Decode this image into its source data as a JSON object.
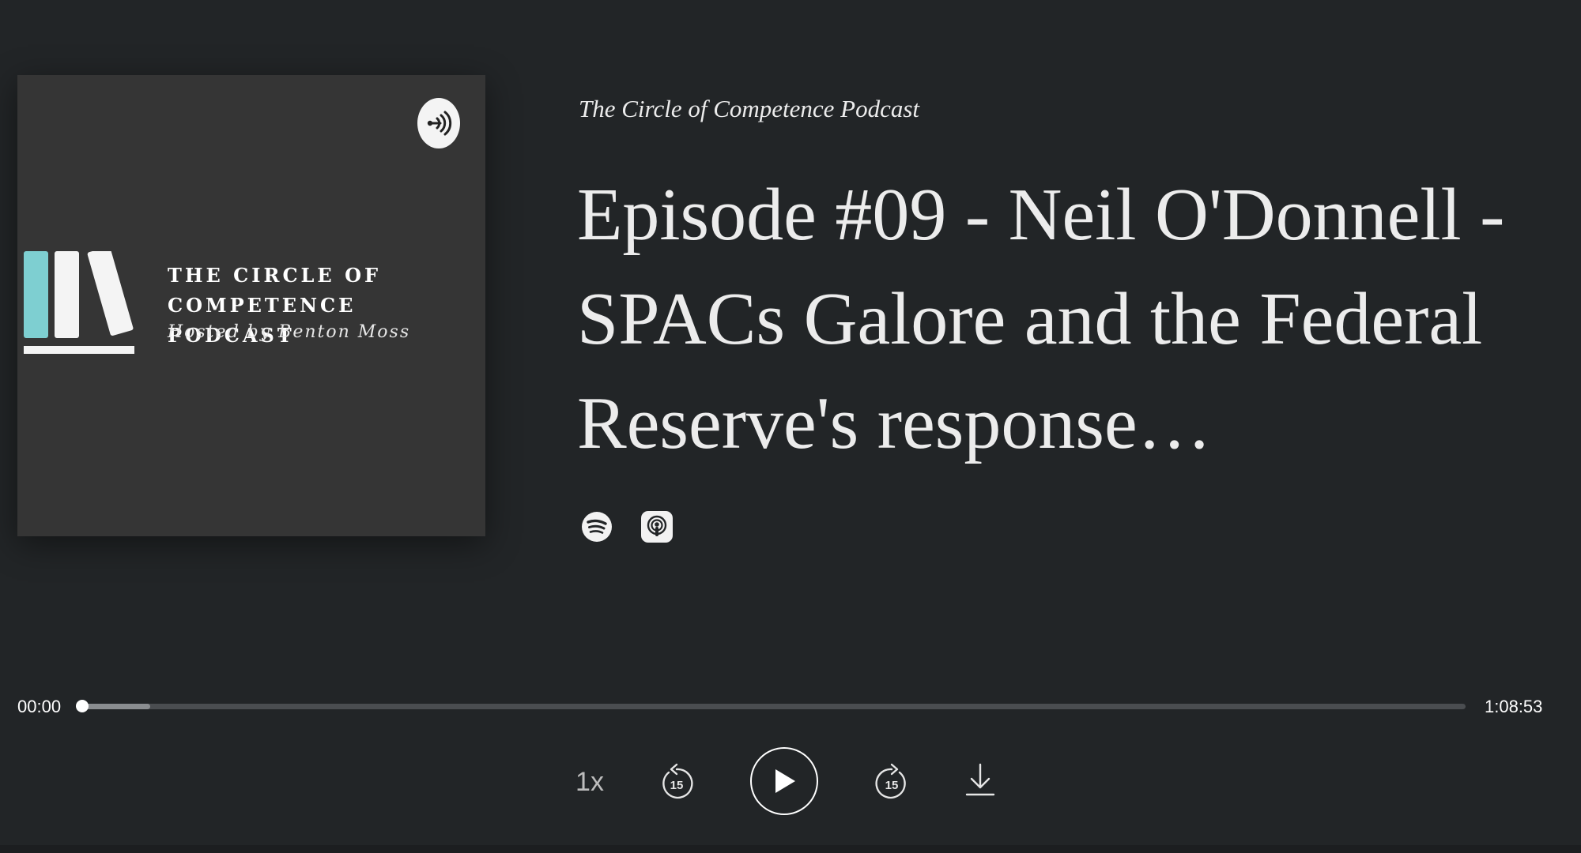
{
  "podcast": {
    "cover": {
      "title": "THE CIRCLE OF\nCOMPETENCE PODCAST",
      "subtitle": "Hosted by Benton Moss",
      "logo_icon": "books-icon",
      "badge_icon": "anchor-icon"
    },
    "show_name": "The Circle of Competence Podcast",
    "episode_title": "Episode #09 - Neil O'Donnell - SPACs Galore and the Federal Reserve's response…",
    "platforms": [
      {
        "name": "Spotify",
        "icon": "spotify-icon"
      },
      {
        "name": "Apple Podcasts",
        "icon": "apple-podcasts-icon"
      }
    ]
  },
  "player": {
    "current_time": "00:00",
    "total_time": "1:08:53",
    "progress": 0,
    "buffered": 0.05,
    "speed_label": "1x",
    "skip_back_seconds": "15",
    "skip_forward_seconds": "15",
    "play_icon": "play-icon",
    "download_icon": "download-icon"
  },
  "colors": {
    "background": "#222527",
    "cover_background": "#353535",
    "logo_accent": "#7ecfd1",
    "text": "#ececec"
  }
}
